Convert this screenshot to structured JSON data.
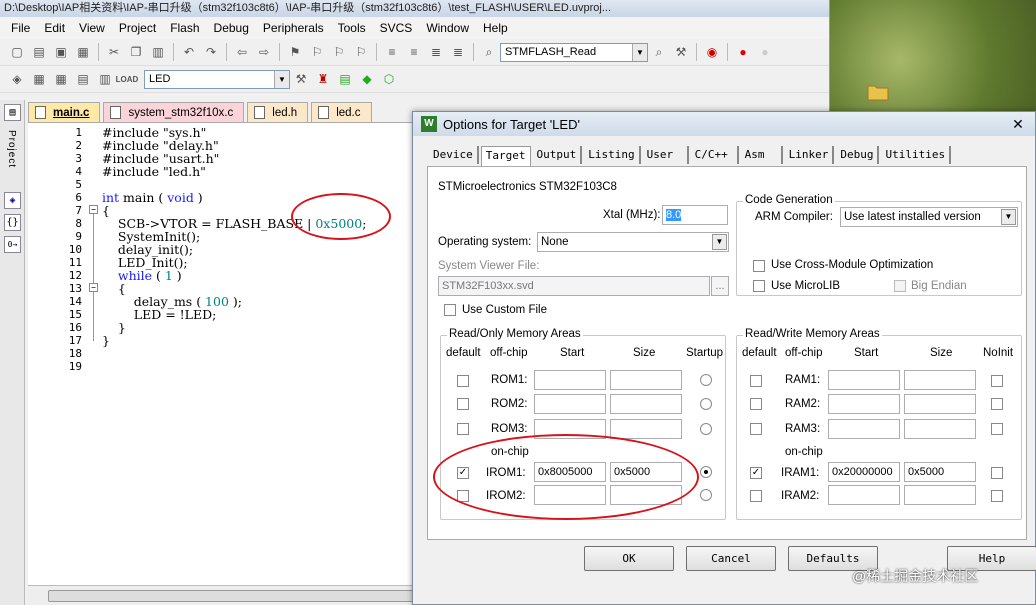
{
  "ide": {
    "title": "D:\\Desktop\\IAP相关资料\\IAP-串口升级（stm32f103c8t6）\\IAP-串口升级（stm32f103c8t6）\\test_FLASH\\USER\\LED.uvproj...",
    "menu": [
      "File",
      "Edit",
      "View",
      "Project",
      "Flash",
      "Debug",
      "Peripherals",
      "Tools",
      "SVCS",
      "Window",
      "Help"
    ],
    "toolbar_combo": "STMFLASH_Read",
    "target_combo": "LED",
    "side_label": "Project",
    "tabs": [
      "main.c",
      "system_stm32f10x.c",
      "led.h",
      "led.c"
    ],
    "code_lines": [
      "#include \"sys.h\"",
      "#include \"delay.h\"",
      "#include \"usart.h\"",
      "#include \"led.h\"",
      "",
      "int main ( void )",
      "{",
      "    SCB->VTOR = FLASH_BASE | 0x5000;",
      "    SystemInit();",
      "    delay_init();",
      "    LED_Init();",
      "    while ( 1 )",
      "    {",
      "        delay_ms ( 100 );",
      "        LED = !LED;",
      "    }",
      "}",
      "",
      ""
    ],
    "code": {
      "l1": "#include \"sys.h\"",
      "l2": "#include \"delay.h\"",
      "l3": "#include \"usart.h\"",
      "l4": "#include \"led.h\"",
      "l6_kw": "int",
      "l6_rest": " main ( ",
      "l6_kw2": "void",
      "l6_end": " )",
      "l7": "{",
      "l8_a": "    SCB->VTOR = FLASH_BASE | ",
      "l8_num": "0x5000",
      "l8_end": ";",
      "l9": "    SystemInit();",
      "l10": "    delay_init();",
      "l11": "    LED_Init();",
      "l12_kw": "    while",
      "l12_rest": " ( ",
      "l12_num": "1",
      "l12_end": " )",
      "l13": "    {",
      "l14_a": "        delay_ms ( ",
      "l14_num": "100",
      "l14_end": " );",
      "l15": "        LED = !LED;",
      "l16": "    }",
      "l17": "}"
    }
  },
  "dialog": {
    "title": "Options for Target 'LED'",
    "tabs": [
      "Device",
      "Target",
      "Output",
      "Listing",
      "User",
      "C/C++",
      "Asm",
      "Linker",
      "Debug",
      "Utilities"
    ],
    "device": "STMicroelectronics STM32F103C8",
    "xtal_label": "Xtal (MHz):",
    "xtal_value": "8.0",
    "os_label": "Operating system:",
    "os_value": "None",
    "svf_label": "System Viewer File:",
    "svf_value": "STM32F103xx.svd",
    "svf_browse": "...",
    "custom_file": "Use Custom File",
    "code_gen": "Code Generation",
    "compiler_label": "ARM Compiler:",
    "compiler_value": "Use latest installed version",
    "cross_module": "Use Cross-Module Optimization",
    "microlib": "Use MicroLIB",
    "big_endian": "Big Endian",
    "ro_title": "Read/Only Memory Areas",
    "rw_title": "Read/Write Memory Areas",
    "col_default": "default",
    "col_offchip": "off-chip",
    "col_start": "Start",
    "col_size": "Size",
    "col_startup": "Startup",
    "col_noinit": "NoInit",
    "onchip": "on-chip",
    "rom": [
      {
        "name": "ROM1:",
        "start": "",
        "size": "",
        "default": false,
        "startup": false
      },
      {
        "name": "ROM2:",
        "start": "",
        "size": "",
        "default": false,
        "startup": false
      },
      {
        "name": "ROM3:",
        "start": "",
        "size": "",
        "default": false,
        "startup": false
      },
      {
        "name": "IROM1:",
        "start": "0x8005000",
        "size": "0x5000",
        "default": true,
        "startup": true
      },
      {
        "name": "IROM2:",
        "start": "",
        "size": "",
        "default": false,
        "startup": false
      }
    ],
    "ram": [
      {
        "name": "RAM1:",
        "start": "",
        "size": "",
        "default": false,
        "noinit": false
      },
      {
        "name": "RAM2:",
        "start": "",
        "size": "",
        "default": false,
        "noinit": false
      },
      {
        "name": "RAM3:",
        "start": "",
        "size": "",
        "default": false,
        "noinit": false
      },
      {
        "name": "IRAM1:",
        "start": "0x20000000",
        "size": "0x5000",
        "default": true,
        "noinit": false
      },
      {
        "name": "IRAM2:",
        "start": "",
        "size": "",
        "default": false,
        "noinit": false
      }
    ],
    "buttons": {
      "ok": "OK",
      "cancel": "Cancel",
      "defaults": "Defaults",
      "help": "Help"
    }
  },
  "watermark": "@稀土掘金技术社区",
  "colors": {
    "annotation": "#d7131b",
    "number": "#008080",
    "keyword": "#1a1aff"
  }
}
